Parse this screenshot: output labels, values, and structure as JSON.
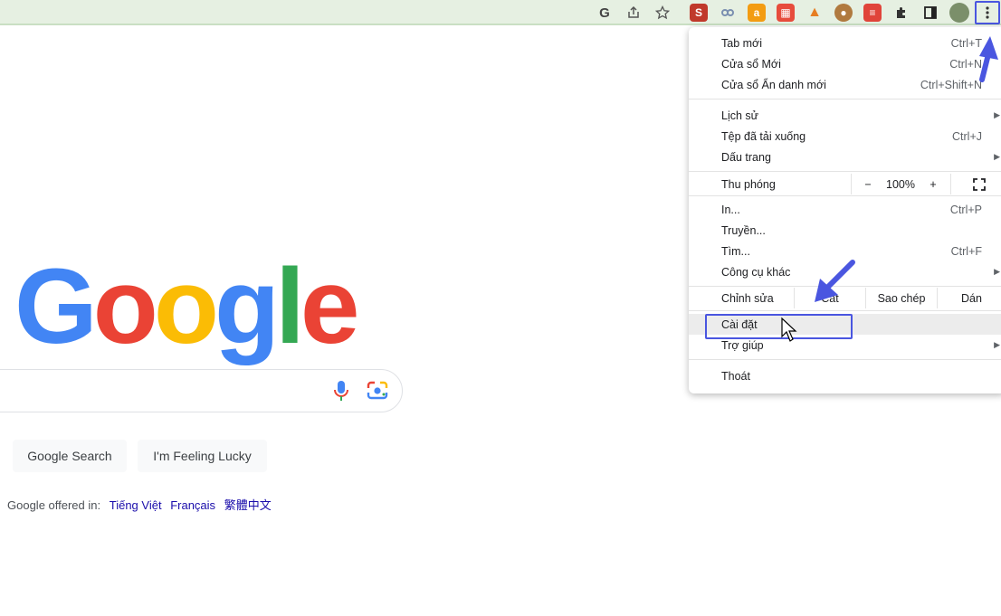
{
  "toolbar": {
    "google_icon": "G",
    "share_icon": "share-icon",
    "star_icon": "star-icon",
    "extensions": [
      "S",
      "link",
      "a",
      "grid",
      "fire",
      "cookie",
      "todo"
    ],
    "colors": {
      "highlight": "#4a56e0"
    }
  },
  "menu": {
    "new_tab": {
      "label": "Tab mới",
      "shortcut": "Ctrl+T"
    },
    "new_window": {
      "label": "Cửa sổ Mới",
      "shortcut": "Ctrl+N"
    },
    "incognito": {
      "label": "Cửa sổ Ẩn danh mới",
      "shortcut": "Ctrl+Shift+N"
    },
    "history": {
      "label": "Lịch sử"
    },
    "downloads": {
      "label": "Tệp đã tải xuống",
      "shortcut": "Ctrl+J"
    },
    "bookmarks": {
      "label": "Dấu trang"
    },
    "zoom": {
      "label": "Thu phóng",
      "minus": "−",
      "value": "100%",
      "plus": "+"
    },
    "print": {
      "label": "In...",
      "shortcut": "Ctrl+P"
    },
    "cast": {
      "label": "Truyền..."
    },
    "find": {
      "label": "Tìm...",
      "shortcut": "Ctrl+F"
    },
    "more_tools": {
      "label": "Công cụ khác"
    },
    "edit": {
      "label": "Chỉnh sửa",
      "cut": "Cắt",
      "copy": "Sao chép",
      "paste": "Dán"
    },
    "settings": {
      "label": "Cài đặt"
    },
    "help": {
      "label": "Trợ giúp"
    },
    "exit": {
      "label": "Thoát"
    }
  },
  "google": {
    "logo": [
      "G",
      "o",
      "o",
      "g",
      "l",
      "e"
    ],
    "buttons": {
      "search": "Google Search",
      "lucky": "I'm Feeling Lucky"
    },
    "offered_in": "Google offered in:",
    "languages": [
      "Tiếng Việt",
      "Français",
      "繁體中文"
    ]
  }
}
